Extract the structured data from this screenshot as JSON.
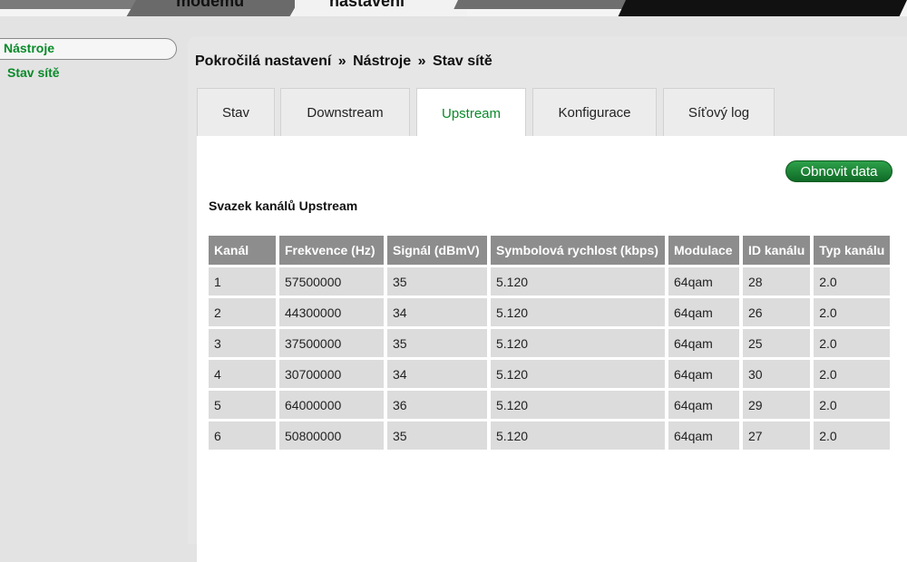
{
  "header": {
    "tab_modem": "modemu",
    "tab_settings": "nastavení"
  },
  "sidebar": {
    "items": [
      {
        "label": "Nástroje"
      },
      {
        "label": "Stav sítě"
      }
    ]
  },
  "breadcrumb": {
    "items": [
      "Pokročilá nastavení",
      "Nástroje",
      "Stav sítě"
    ],
    "separator": "»"
  },
  "tabs": [
    {
      "label": "Stav"
    },
    {
      "label": "Downstream"
    },
    {
      "label": "Upstream"
    },
    {
      "label": "Konfigurace"
    },
    {
      "label": "Síťový log"
    }
  ],
  "active_tab": "Upstream",
  "refresh_button": "Obnovit data",
  "section_title": "Svazek kanálů Upstream",
  "table": {
    "headers": [
      "Kanál",
      "Frekvence (Hz)",
      "Signál (dBmV)",
      "Symbolová rychlost (kbps)",
      "Modulace",
      "ID kanálu",
      "Typ kanálu"
    ],
    "rows": [
      [
        "1",
        "57500000",
        "35",
        "5.120",
        "64qam",
        "28",
        "2.0"
      ],
      [
        "2",
        "44300000",
        "34",
        "5.120",
        "64qam",
        "26",
        "2.0"
      ],
      [
        "3",
        "37500000",
        "35",
        "5.120",
        "64qam",
        "25",
        "2.0"
      ],
      [
        "4",
        "30700000",
        "34",
        "5.120",
        "64qam",
        "30",
        "2.0"
      ],
      [
        "5",
        "64000000",
        "36",
        "5.120",
        "64qam",
        "29",
        "2.0"
      ],
      [
        "6",
        "50800000",
        "35",
        "5.120",
        "64qam",
        "27",
        "2.0"
      ]
    ]
  },
  "colors": {
    "accent_green": "#0a8a2a",
    "header_gray": "#8d8d8d",
    "cell_gray": "#dcdcdc"
  }
}
